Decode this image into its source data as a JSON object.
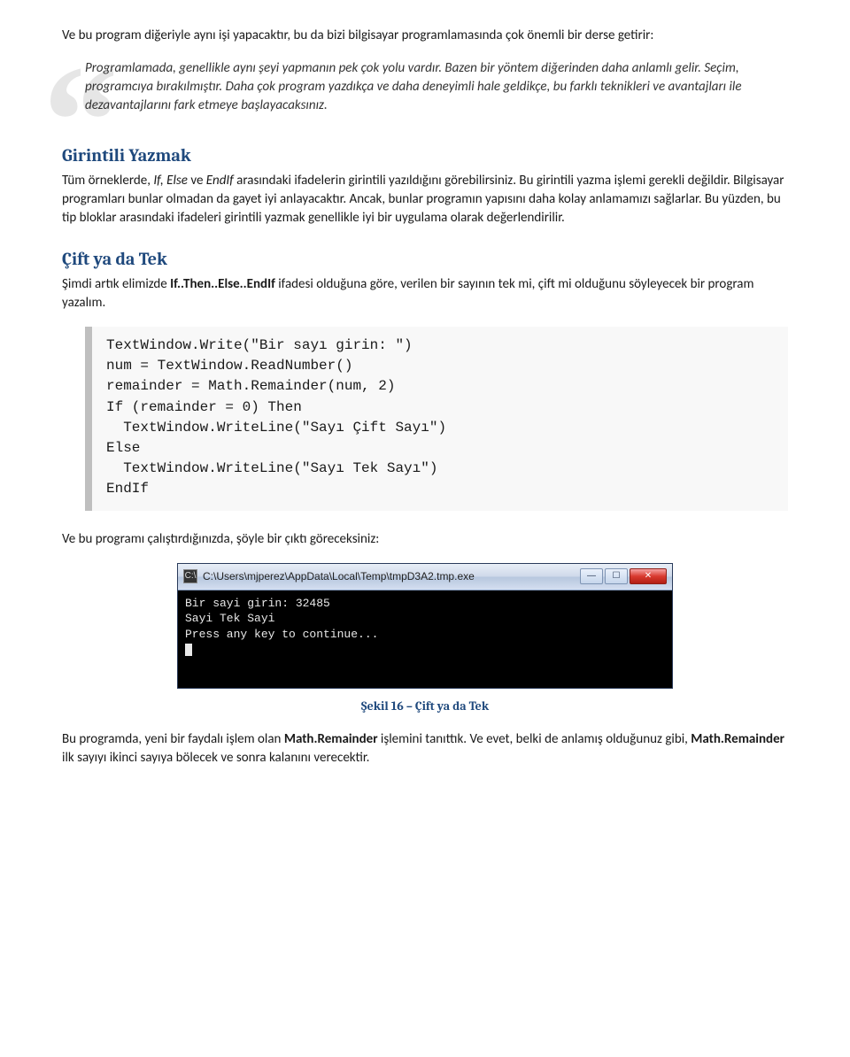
{
  "intro": {
    "para1": "Ve bu program diğeriyle aynı işi yapacaktır, bu da bizi bilgisayar programlamasında çok önemli bir derse getirir:"
  },
  "quote": {
    "text": "Programlamada, genellikle aynı şeyi yapmanın pek çok yolu vardır. Bazen bir yöntem diğerinden daha anlamlı gelir. Seçim, programcıya bırakılmıştır. Daha çok program yazdıkça ve daha deneyimli hale geldikçe, bu farklı teknikleri ve avantajları ile dezavantajlarını fark etmeye başlayacaksınız."
  },
  "section1": {
    "heading": "Girintili Yazmak",
    "body_pre": "Tüm örneklerde, ",
    "body_em": "If, Else",
    "body_mid1": " ve ",
    "body_em2": "EndIf",
    "body_post": " arasındaki ifadelerin girintili yazıldığını görebilirsiniz. Bu girintili yazma işlemi gerekli değildir. Bilgisayar programları bunlar olmadan da gayet iyi anlayacaktır. Ancak, bunlar programın yapısını daha kolay anlamamızı sağlarlar. Bu yüzden, bu tip bloklar arasındaki ifadeleri girintili yazmak genellikle iyi bir uygulama olarak değerlendirilir."
  },
  "section2": {
    "heading": "Çift ya da Tek",
    "body_pre": "Şimdi artık elimizde ",
    "body_strong": "If..Then..Else..EndIf",
    "body_post": " ifadesi olduğuna göre, verilen bir sayının tek mi, çift mi olduğunu söyleyecek bir program yazalım."
  },
  "code": {
    "l1": "TextWindow.Write(\"Bir sayı girin: \")",
    "l2": "num = TextWindow.ReadNumber()",
    "l3": "remainder = Math.Remainder(num, 2)",
    "l4": "If (remainder = 0) Then",
    "l5": "  TextWindow.WriteLine(\"Sayı Çift Sayı\")",
    "l6": "Else",
    "l7": "  TextWindow.WriteLine(\"Sayı Tek Sayı\")",
    "l8": "EndIf"
  },
  "after_code": "Ve bu programı çalıştırdığınızda, şöyle bir çıktı göreceksiniz:",
  "console": {
    "title": "C:\\Users\\mjperez\\AppData\\Local\\Temp\\tmpD3A2.tmp.exe",
    "line1": "Bir sayi girin: 32485",
    "line2": "Sayi Tek Sayi",
    "line3": "Press any key to continue..."
  },
  "caption": "Şekil 16 – Çift ya da Tek",
  "closing": {
    "pre": "Bu programda, yeni bir faydalı işlem olan ",
    "strong1": "Math.Remainder",
    "mid": " işlemini tanıttık. Ve evet, belki de anlamış olduğunuz gibi, ",
    "strong2": "Math.Remainder",
    "post": " ilk sayıyı ikinci sayıya bölecek ve sonra kalanını verecektir."
  }
}
